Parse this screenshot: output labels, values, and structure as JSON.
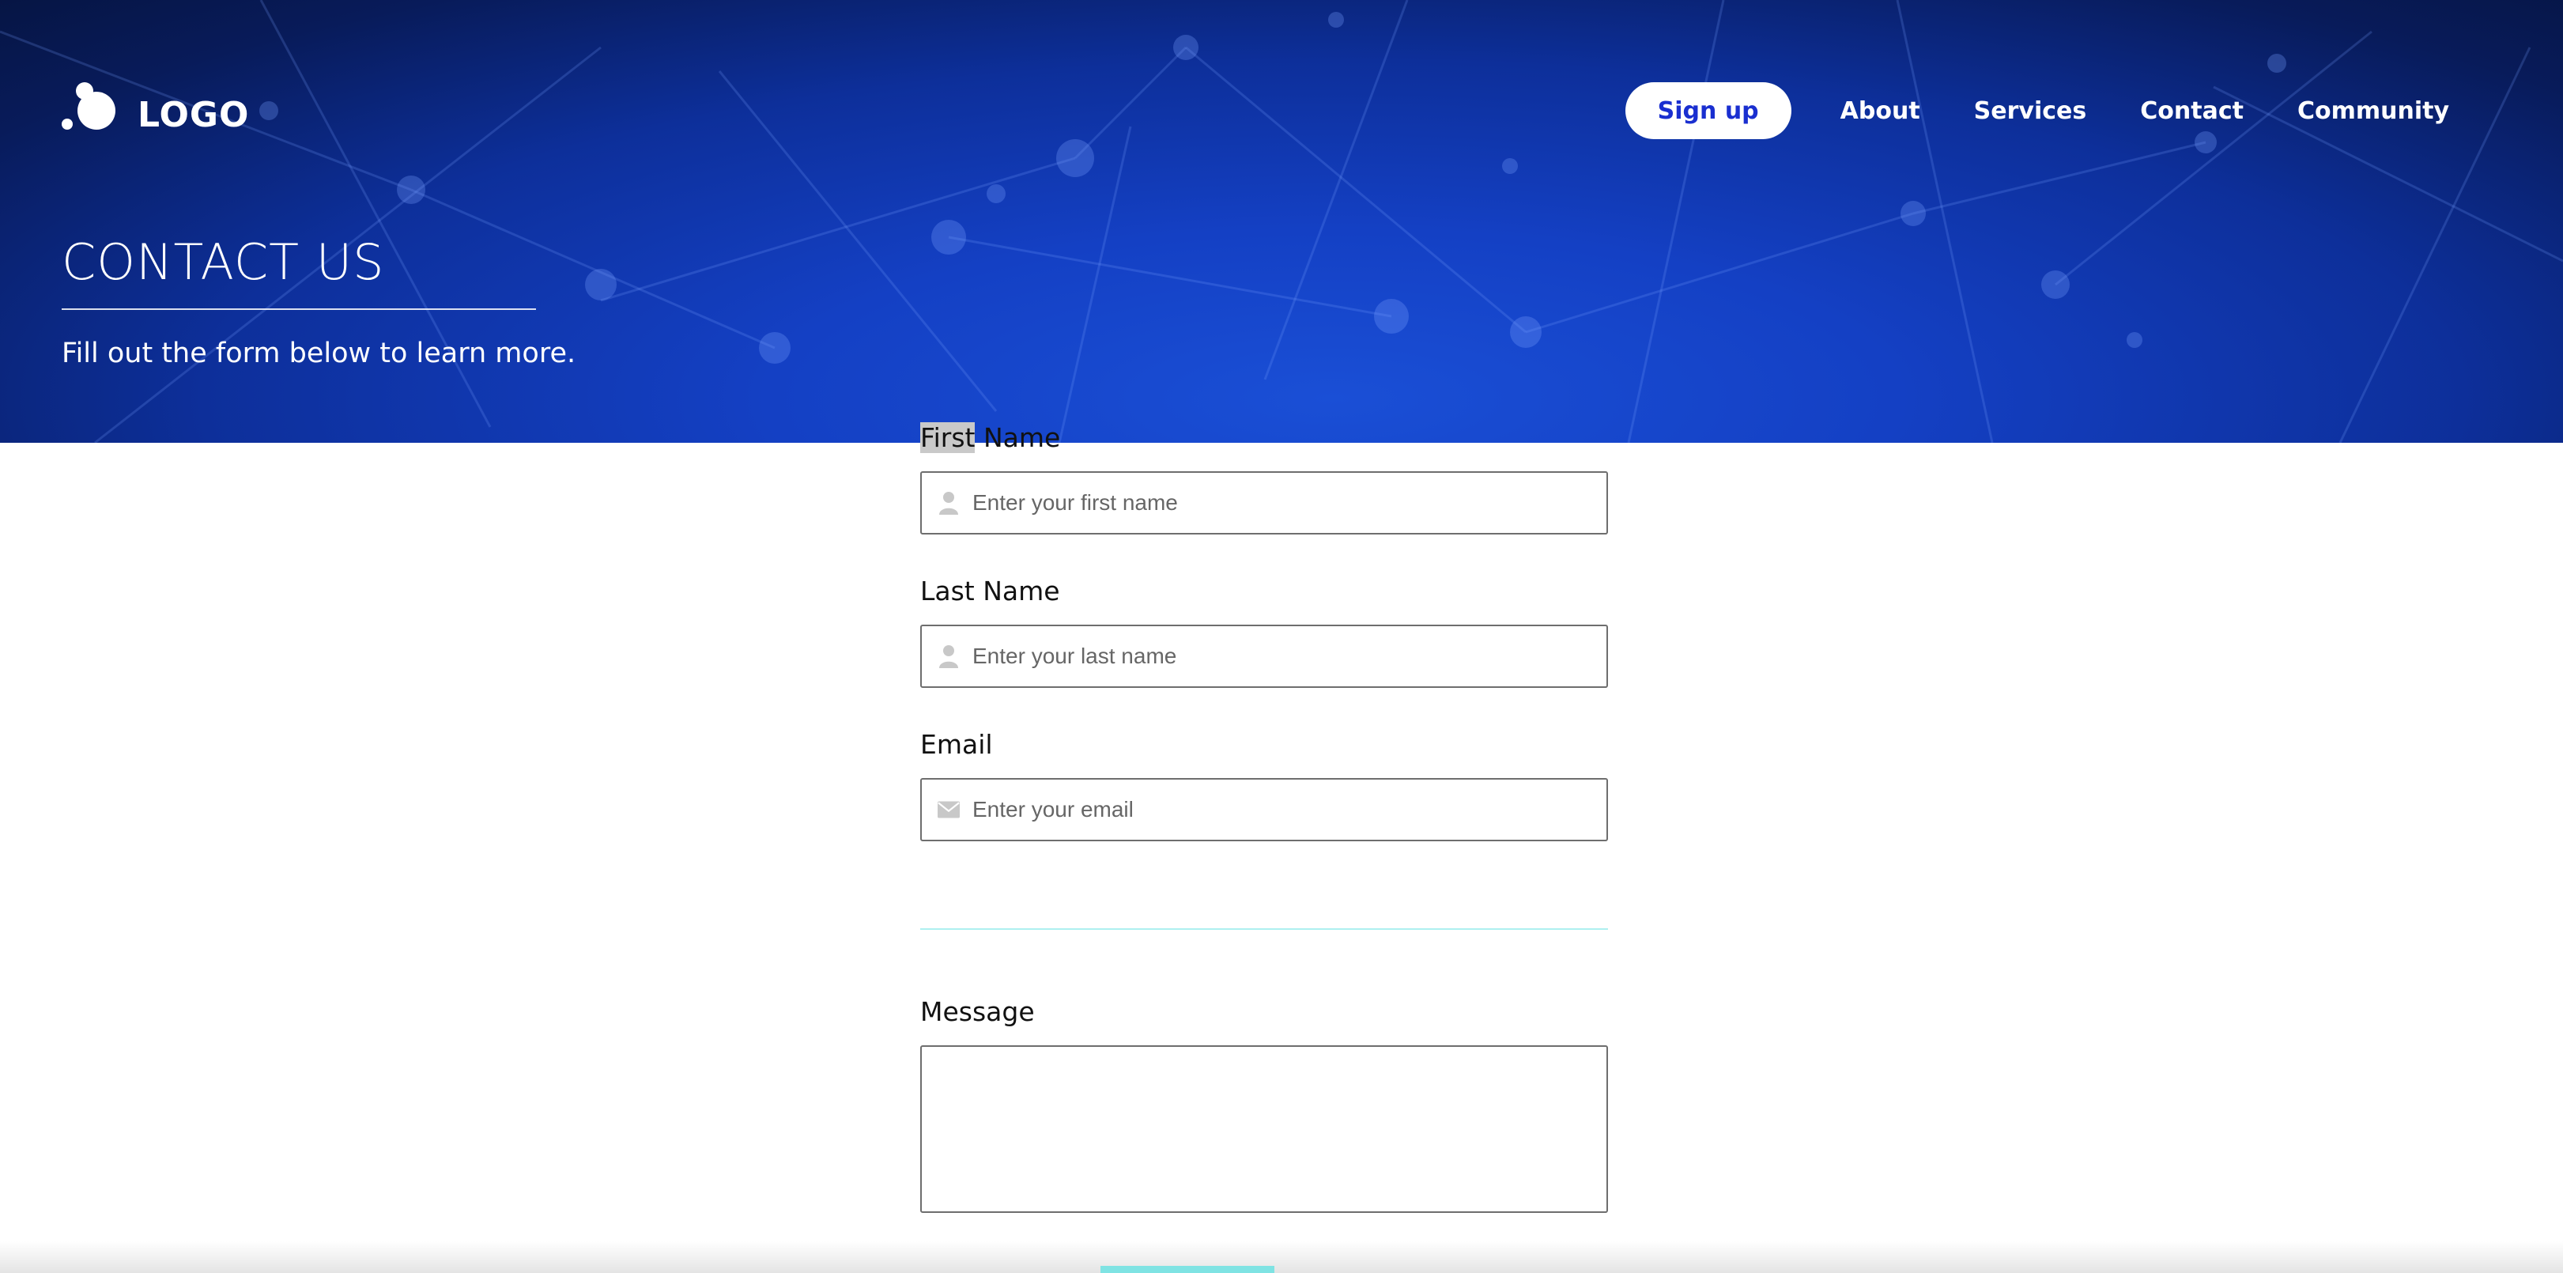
{
  "brand": {
    "logo_text": "LOGO"
  },
  "nav": {
    "signup_label": "Sign up",
    "links": [
      "About",
      "Services",
      "Contact",
      "Community"
    ]
  },
  "hero": {
    "title": "CONTACT US",
    "subtitle": "Fill out the form below to learn more."
  },
  "form": {
    "first_name": {
      "label_highlighted": "First",
      "label_rest": " Name",
      "placeholder": "Enter your first name",
      "icon": "user-icon"
    },
    "last_name": {
      "label": "Last Name",
      "placeholder": "Enter your last name",
      "icon": "user-icon"
    },
    "email": {
      "label": "Email",
      "placeholder": "Enter your email",
      "icon": "envelope-icon"
    },
    "message": {
      "label": "Message",
      "placeholder": ""
    }
  },
  "colors": {
    "hero_blue": "#1440c4",
    "signup_text": "#1a2fd0",
    "accent_cyan": "#7fe3e3"
  }
}
